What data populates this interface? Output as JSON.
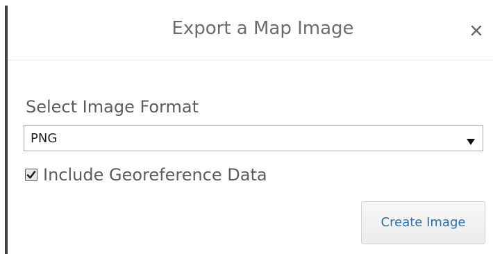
{
  "dialog": {
    "title": "Export a Map Image",
    "close_icon": "close-icon"
  },
  "format": {
    "label": "Select Image Format",
    "selected": "PNG",
    "arrow_icon": "dropdown-arrow-icon"
  },
  "georeference": {
    "label": "Include Georeference Data",
    "checked": true
  },
  "actions": {
    "create_label": "Create Image"
  },
  "colors": {
    "title": "#6b6b6b",
    "label": "#5c5c5c",
    "button_text": "#2d6ea8",
    "left_border": "#3f3f3f"
  }
}
